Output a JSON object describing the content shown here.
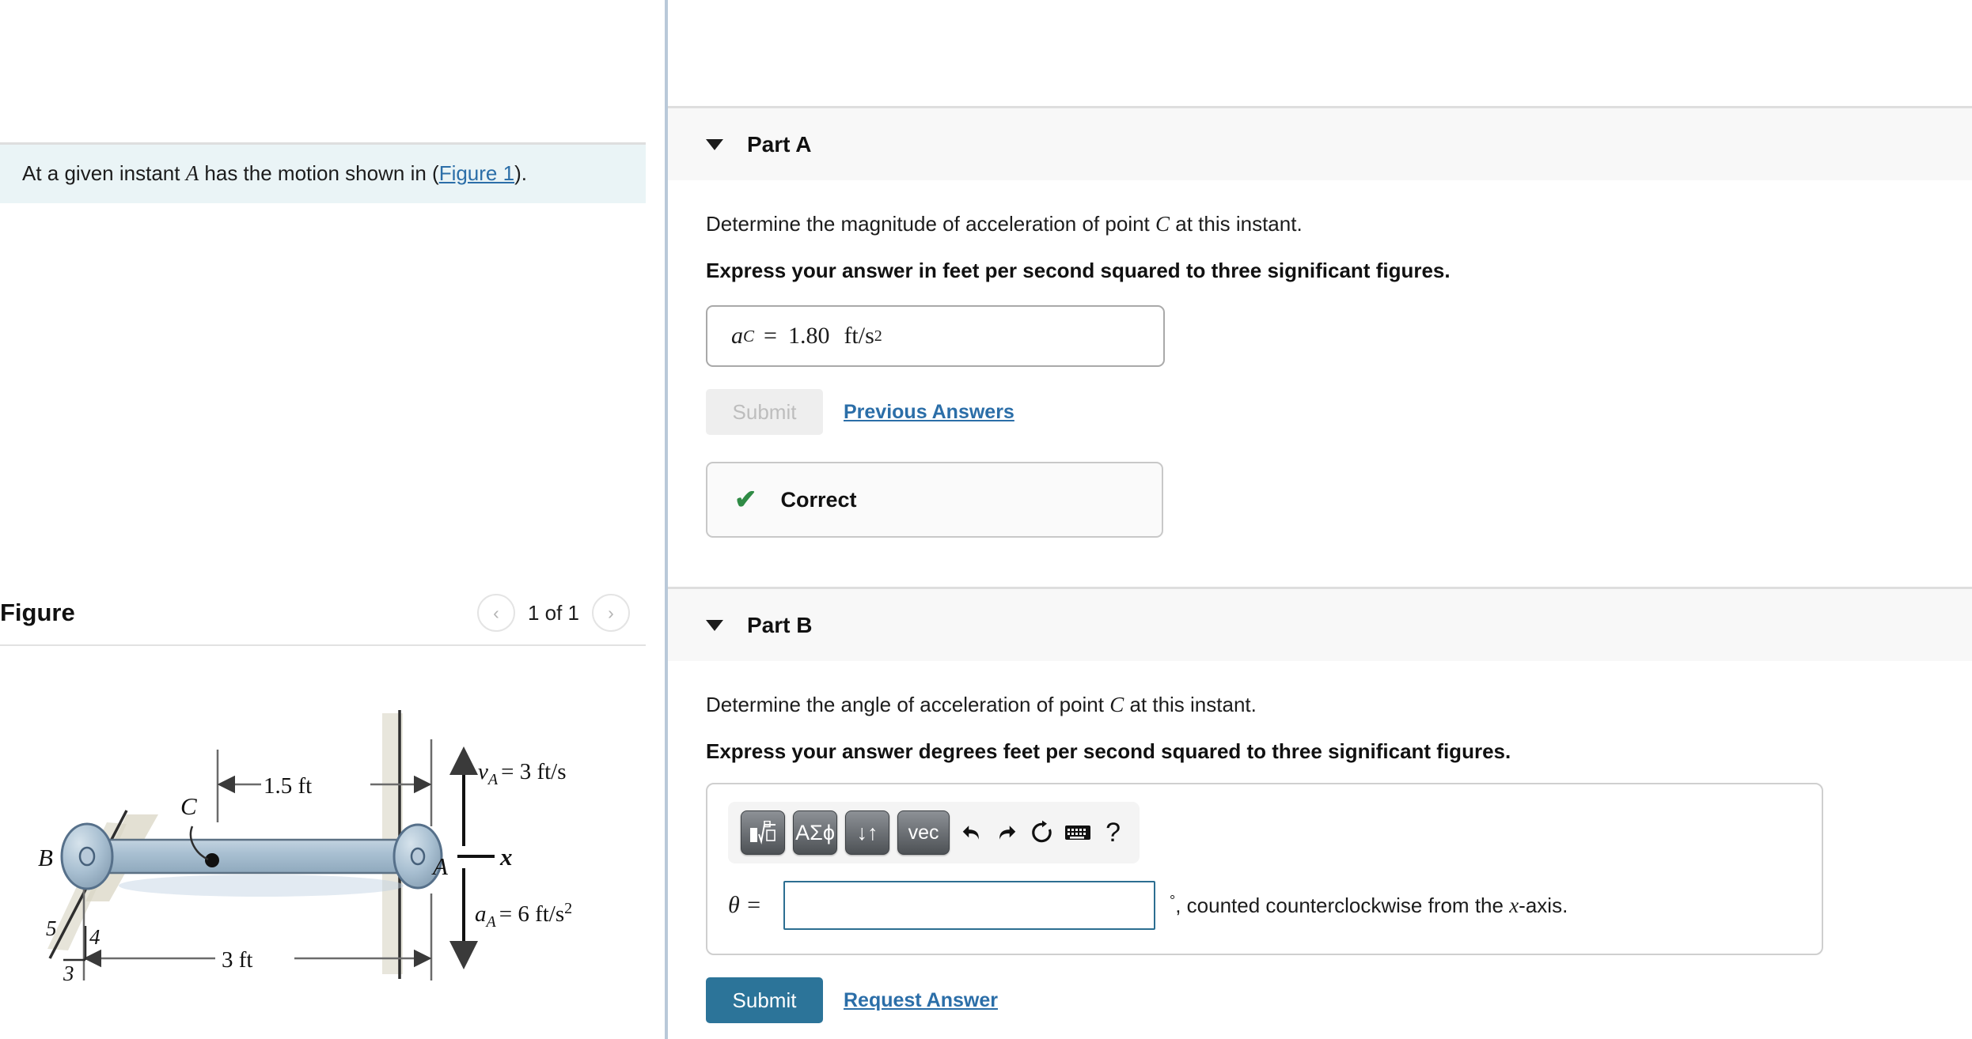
{
  "problem": {
    "text_before": "At a given instant ",
    "symbol_A": "A",
    "text_middle": " has the motion shown in (",
    "figure_link": "Figure 1",
    "text_after": ")."
  },
  "figure_panel": {
    "title": "Figure",
    "prev_label": "‹",
    "next_label": "›",
    "pager_label": "1 of 1"
  },
  "figure": {
    "label_B": "B",
    "label_A": "A",
    "label_C": "C",
    "label_x": "x",
    "dim_top": "1.5 ft",
    "dim_bottom": "3 ft",
    "velocity_label": "v",
    "velocity_sub": "A",
    "velocity_value": "= 3 ft/s",
    "accel_label": "a",
    "accel_sub": "A",
    "accel_value": "= 6 ft/s",
    "accel_exp": "2",
    "slope_5": "5",
    "slope_4": "4",
    "slope_3": "3"
  },
  "part_a": {
    "title": "Part A",
    "question": "Determine the magnitude of acceleration of point ",
    "question_symbol": "C",
    "question_tail": " at this instant.",
    "instruction": "Express your answer in feet per second squared to three significant figures.",
    "answer_symbol": "a",
    "answer_sub": "C",
    "answer_eq": "=",
    "answer_value": "1.80",
    "answer_unit": "ft/s",
    "answer_unit_exp": "2",
    "submit_label": "Submit",
    "previous_answers_label": "Previous Answers",
    "feedback_icon": "check-icon",
    "feedback_label": "Correct"
  },
  "part_b": {
    "title": "Part B",
    "question": "Determine the angle of acceleration of point ",
    "question_symbol": "C",
    "question_tail": " at this instant.",
    "instruction": "Express your answer degrees feet per second squared to three significant figures.",
    "toolbar": [
      {
        "name": "template-root-button",
        "label": "■√□"
      },
      {
        "name": "greek-symbols-button",
        "label": "ΑΣϕ"
      },
      {
        "name": "updown-arrows-button",
        "label": "↓↑"
      },
      {
        "name": "vector-button",
        "label": "vec"
      },
      {
        "name": "undo-icon",
        "label": "↶"
      },
      {
        "name": "redo-icon",
        "label": "↷"
      },
      {
        "name": "reset-icon",
        "label": "⟳"
      },
      {
        "name": "keyboard-icon",
        "label": "⌨"
      },
      {
        "name": "help-icon",
        "label": "?"
      }
    ],
    "theta_label": "θ =",
    "theta_value": "",
    "theta_placeholder": "",
    "unit_degree": "°",
    "unit_text": ", counted counterclockwise from the ",
    "unit_symbol": "x",
    "unit_tail": "-axis.",
    "submit_label": "Submit",
    "request_answer_label": "Request Answer"
  },
  "colors": {
    "accent": "#2c7499",
    "link": "#2b6ea8",
    "correct": "#2f8b45",
    "panel_bg": "#f8f8f8",
    "statement_bg": "#eaf4f6",
    "divider": "#b9c9d9"
  }
}
